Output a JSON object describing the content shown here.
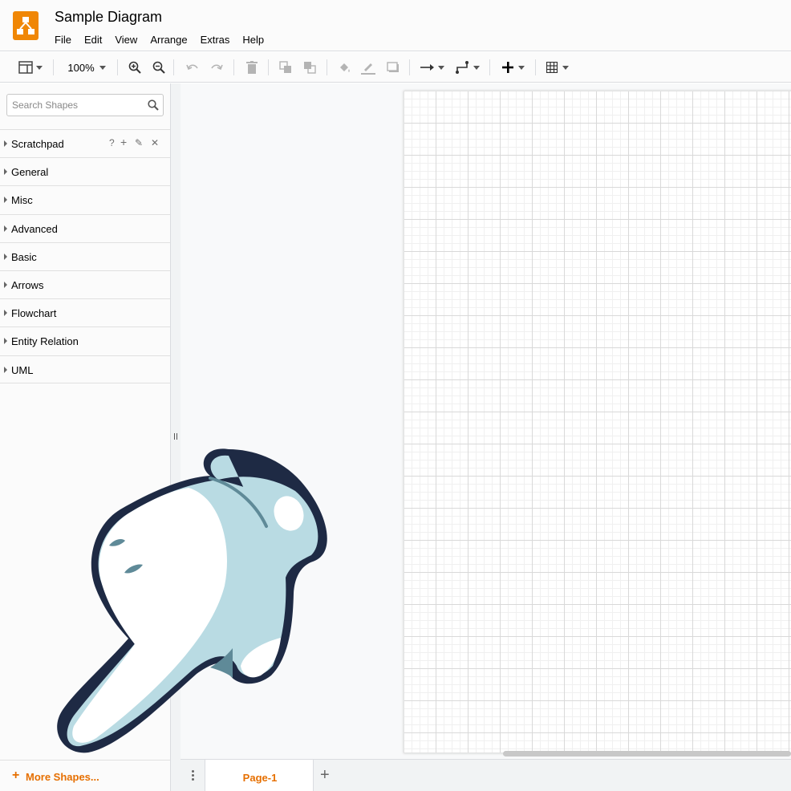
{
  "app": {
    "title": "Sample Diagram",
    "menu": [
      "File",
      "Edit",
      "View",
      "Arrange",
      "Extras",
      "Help"
    ]
  },
  "toolbar": {
    "zoom": "100%",
    "icons": [
      "format-panel-icon",
      "zoom-in-icon",
      "zoom-out-icon",
      "undo-icon",
      "redo-icon",
      "delete-icon",
      "to-front-icon",
      "to-back-icon",
      "fill-color-icon",
      "line-color-icon",
      "shadow-icon",
      "connection-icon",
      "waypoints-icon",
      "insert-icon",
      "table-icon"
    ]
  },
  "sidebar": {
    "search_placeholder": "Search Shapes",
    "palettes": [
      "Scratchpad",
      "General",
      "Misc",
      "Advanced",
      "Basic",
      "Arrows",
      "Flowchart",
      "Entity Relation",
      "UML"
    ],
    "scratchpad_tools": [
      "?",
      "+",
      "✎",
      "✕"
    ],
    "more_shapes": "More Shapes..."
  },
  "footer": {
    "page_tab": "Page-1",
    "add_page": "+"
  },
  "colors": {
    "brand": "#f08705",
    "accent": "#e66f00",
    "hand_fill": "#b9dbe3",
    "hand_outline": "#1e2a44"
  }
}
